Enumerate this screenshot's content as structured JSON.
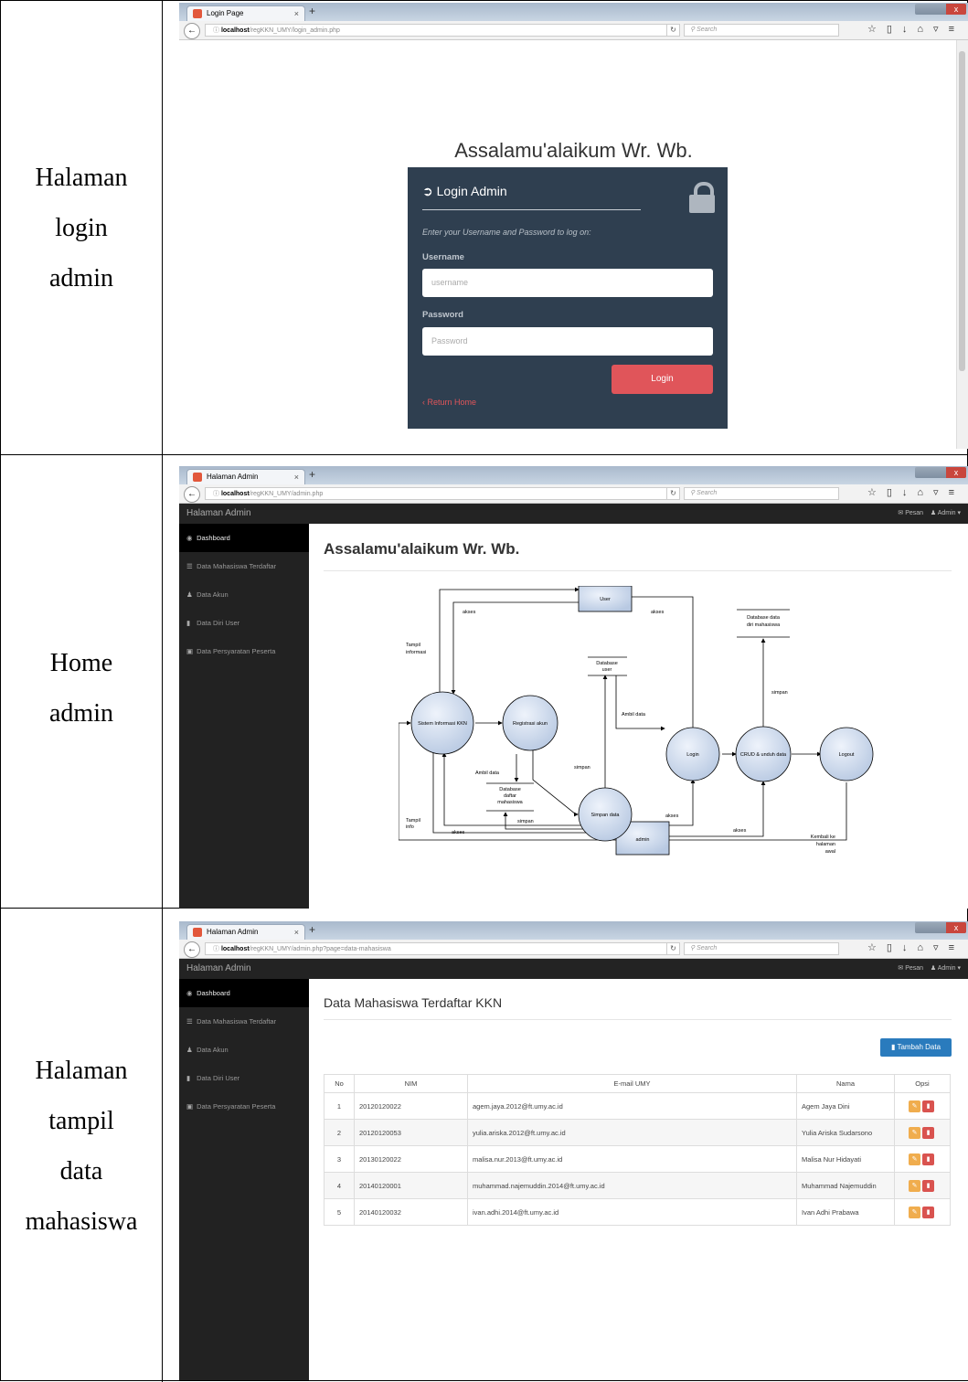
{
  "rows": [
    {
      "label_lines": [
        "Halaman",
        "login",
        "admin"
      ]
    },
    {
      "label_lines": [
        "Home",
        "admin"
      ]
    },
    {
      "label_lines": [
        "Halaman",
        "tampil",
        "data",
        "mahasiswa"
      ]
    }
  ],
  "login_shot": {
    "tab_title": "Login Page",
    "url_host": "localhost",
    "url_path": "/regKKN_UMY/login_admin.php",
    "search_placeholder": "Search",
    "greeting": "Assalamu'alaikum Wr. Wb.",
    "box_title": "Login Admin",
    "instruction": "Enter your Username and Password to log on:",
    "username_label": "Username",
    "username_placeholder": "username",
    "password_label": "Password",
    "password_placeholder": "Password",
    "login_button": "Login",
    "return_link": "Return Home"
  },
  "home_shot": {
    "tab_title": "Halaman Admin",
    "url_host": "localhost",
    "url_path": "/regKKN_UMY/admin.php",
    "search_placeholder": "Search",
    "brand": "Halaman Admin",
    "nav_right": {
      "messages": "Pesan",
      "user": "Admin"
    },
    "sidebar": [
      "Dashboard",
      "Data Mahasiswa Terdaftar",
      "Data Akun",
      "Data Diri User",
      "Data Persyaratan Peserta"
    ],
    "heading": "Assalamu'alaikum Wr. Wb.",
    "diagram": {
      "nodes": {
        "sistem": "Sistem Informasi KKN",
        "registrasi": "Registrasi akun",
        "simpan_data": "Simpan data",
        "login": "Login",
        "crud": "CRUD & unduh data",
        "logout": "Logout",
        "user": "User",
        "admin": "admin",
        "db_user": [
          "Database",
          "user"
        ],
        "db_daftar": [
          "Database",
          "daftar",
          "mahasiswa"
        ],
        "db_diri": [
          "Database data",
          "diri mahasiswa"
        ]
      },
      "labels": {
        "akses": "akses",
        "tampil_informasi": [
          "Tampil",
          "informasi"
        ],
        "tampil_info": [
          "Tampil",
          "info"
        ],
        "ambil_data": "Ambil data",
        "simpan": "simpan",
        "kembali": [
          "Kembali ke",
          "halaman",
          "awal"
        ]
      }
    }
  },
  "table_shot": {
    "tab_title": "Halaman Admin",
    "url_host": "localhost",
    "url_path": "/regKKN_UMY/admin.php?page=data-mahasiswa",
    "search_placeholder": "Search",
    "brand": "Halaman Admin",
    "nav_right": {
      "messages": "Pesan",
      "user": "Admin"
    },
    "sidebar": [
      "Dashboard",
      "Data Mahasiswa Terdaftar",
      "Data Akun",
      "Data Diri User",
      "Data Persyaratan Peserta"
    ],
    "heading": "Data Mahasiswa Terdaftar KKN",
    "add_button": "Tambah Data",
    "columns": [
      "No",
      "NIM",
      "E-mail UMY",
      "Nama",
      "Opsi"
    ],
    "rows": [
      [
        "1",
        "20120120022",
        "agem.jaya.2012@ft.umy.ac.id",
        "Agem Jaya Dini"
      ],
      [
        "2",
        "20120120053",
        "yulia.ariska.2012@ft.umy.ac.id",
        "Yulia Ariska Sudarsono"
      ],
      [
        "3",
        "20130120022",
        "malisa.nur.2013@ft.umy.ac.id",
        "Malisa Nur Hidayati"
      ],
      [
        "4",
        "20140120001",
        "muhammad.najemuddin.2014@ft.umy.ac.id",
        "Muhammad Najemuddin"
      ],
      [
        "5",
        "20140120032",
        "ivan.adhi.2014@ft.umy.ac.id",
        "Ivan Adhi Prabawa"
      ]
    ]
  }
}
